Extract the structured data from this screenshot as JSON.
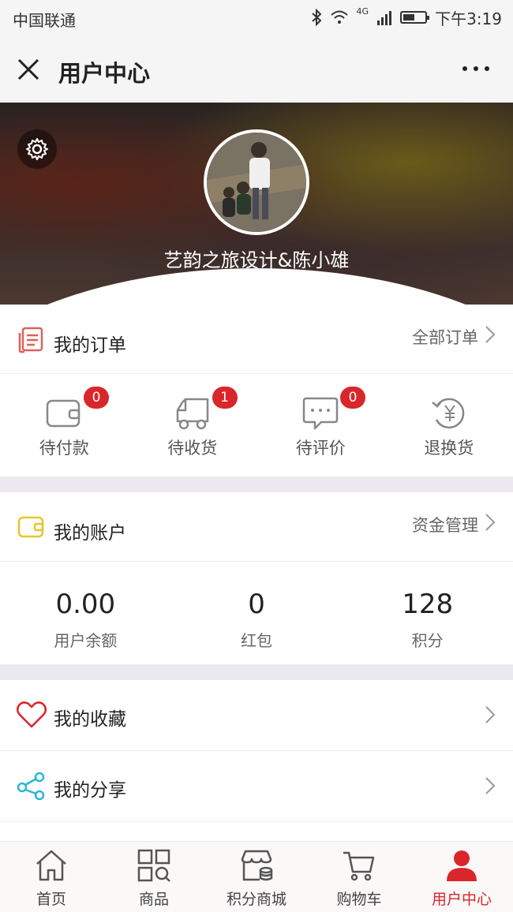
{
  "status": {
    "carrier": "中国联通",
    "network": "4G",
    "time": "下午3:19"
  },
  "nav": {
    "title": "用户中心"
  },
  "profile": {
    "name": "艺韵之旅设计&陈小雄"
  },
  "orders": {
    "title": "我的订单",
    "all_link": "全部订单",
    "items": [
      {
        "label": "待付款",
        "count": "0",
        "icon": "wallet-icon"
      },
      {
        "label": "待收货",
        "count": "1",
        "icon": "truck-icon"
      },
      {
        "label": "待评价",
        "count": "0",
        "icon": "comment-icon"
      },
      {
        "label": "退换货",
        "icon": "yen-return-icon"
      }
    ]
  },
  "account": {
    "title": "我的账户",
    "manage_link": "资金管理",
    "items": [
      {
        "value": "0.00",
        "label": "用户余额"
      },
      {
        "value": "0",
        "label": "红包"
      },
      {
        "value": "128",
        "label": "积分"
      }
    ]
  },
  "favorites": {
    "title": "我的收藏"
  },
  "share": {
    "title": "我的分享"
  },
  "tabs": [
    {
      "label": "首页",
      "icon": "home-icon"
    },
    {
      "label": "商品",
      "icon": "grid-search-icon"
    },
    {
      "label": "积分商城",
      "icon": "store-icon"
    },
    {
      "label": "购物车",
      "icon": "cart-icon"
    },
    {
      "label": "用户中心",
      "icon": "user-icon",
      "active": true
    }
  ],
  "colors": {
    "accent": "#d9262a",
    "order_icon": "#e0605a",
    "account_icon": "#e6c62a",
    "heart": "#d9262a",
    "share": "#2bb5d8"
  }
}
